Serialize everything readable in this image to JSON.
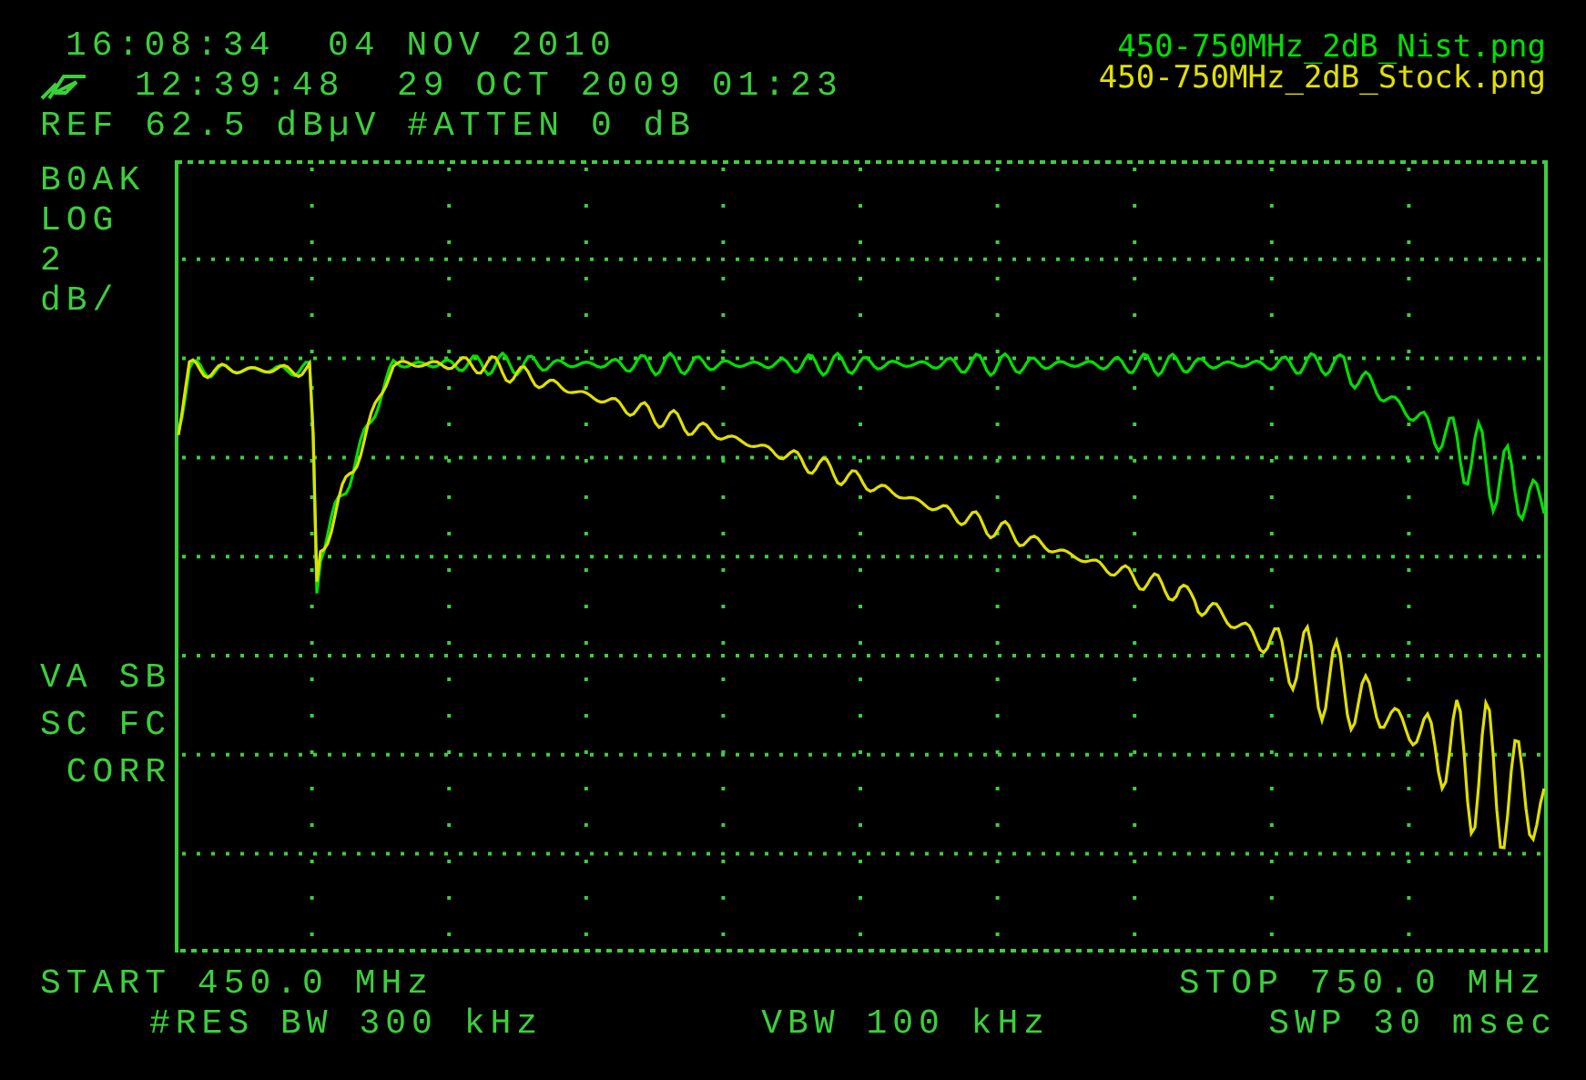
{
  "header": {
    "clock": "16:08:34  04 NOV 2010",
    "saved_time": "12:39:48  29 OCT 2009 01:23",
    "reference": "REF 62.5 dBµV #ATTEN 0 dB"
  },
  "legend": [
    {
      "label": "450-750MHz_2dB_Nist.png",
      "color": "#00e000"
    },
    {
      "label": "450-750MHz_2dB_Stock.png",
      "color": "#e0e000"
    }
  ],
  "scale_labels": [
    "B0AK",
    "LOG",
    "2",
    "dB/"
  ],
  "mode_labels": [
    "VA SB",
    "SC FC",
    " CORR"
  ],
  "footer": {
    "start": "START 450.0 MHz",
    "stop": "STOP 750.0 MHz",
    "res_bw": "#RES BW 300 kHz",
    "vbw": "VBW 100 kHz",
    "sweep": "SWP 30 msec"
  }
}
